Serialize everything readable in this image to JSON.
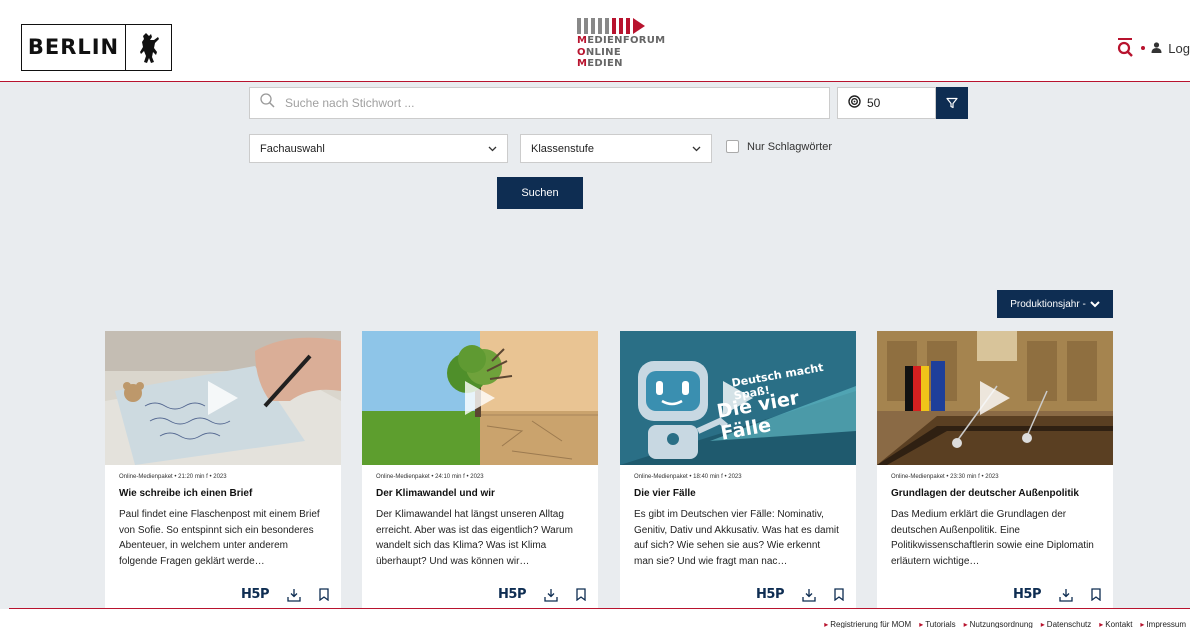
{
  "header": {
    "berlin_logo": "BERLIN",
    "mom_logo": {
      "lines": [
        {
          "initial": "M",
          "rest": "EDIENFORUM"
        },
        {
          "initial": "O",
          "rest": "NLINE"
        },
        {
          "initial": "M",
          "rest": "EDIEN"
        }
      ]
    },
    "login_label": "Log"
  },
  "search": {
    "placeholder": "Suche nach Stichwort ...",
    "count": "50",
    "subject_select": "Fachauswahl",
    "grade_select": "Klassenstufe",
    "keywords_only_label": "Nur Schlagwörter",
    "submit_label": "Suchen"
  },
  "sort": {
    "label": "Produktionsjahr -"
  },
  "cards": [
    {
      "meta": "Online-Medienpaket  •  21:20 min f  •  2023",
      "title": "Wie schreibe ich einen Brief",
      "description": "Paul findet eine Flaschenpost mit einem Brief von Sofie. So entspinnt sich ein besonderes Abenteuer, in welchem unter anderem folgende Fragen geklärt werde…",
      "provider": "H5P"
    },
    {
      "meta": "Online-Medienpaket  •  24:10 min f  •  2023",
      "title": "Der Klimawandel und wir",
      "description": "Der Klimawandel hat längst unseren Alltag erreicht. Aber was ist das eigentlich? Warum wandelt sich das Klima? Was ist Klima überhaupt? Und was können wir…",
      "provider": "H5P"
    },
    {
      "meta": "Online-Medienpaket  •  18:40 min f  •  2023",
      "title": "Die vier Fälle",
      "description": "Es gibt im Deutschen vier Fälle: Nominativ, Genitiv, Dativ und Akkusativ. Was hat es damit auf sich? Wie sehen sie aus? Wie erkennt man sie? Und wie fragt man nac…",
      "provider": "H5P",
      "thumb_text_1": "Deutsch macht Spaß!",
      "thumb_text_2": "Die vier Fälle"
    },
    {
      "meta": "Online-Medienpaket  •  23:30 min f  •  2023",
      "title": "Grundlagen der deutscher Außenpolitik",
      "description": "Das Medium erklärt die Grundlagen der deutschen Außenpolitik. Eine Politikwissenschaftlerin sowie eine Diplomatin erläutern wichtige…",
      "provider": "H5P"
    }
  ],
  "footer": {
    "links": [
      "Registrierung für MOM",
      "Tutorials",
      "Nutzungsordnung",
      "Datenschutz",
      "Kontakt",
      "Impressum"
    ]
  },
  "colors": {
    "brand_red": "#b8132e",
    "navy": "#0e2d52",
    "background": "#e9ecef"
  }
}
